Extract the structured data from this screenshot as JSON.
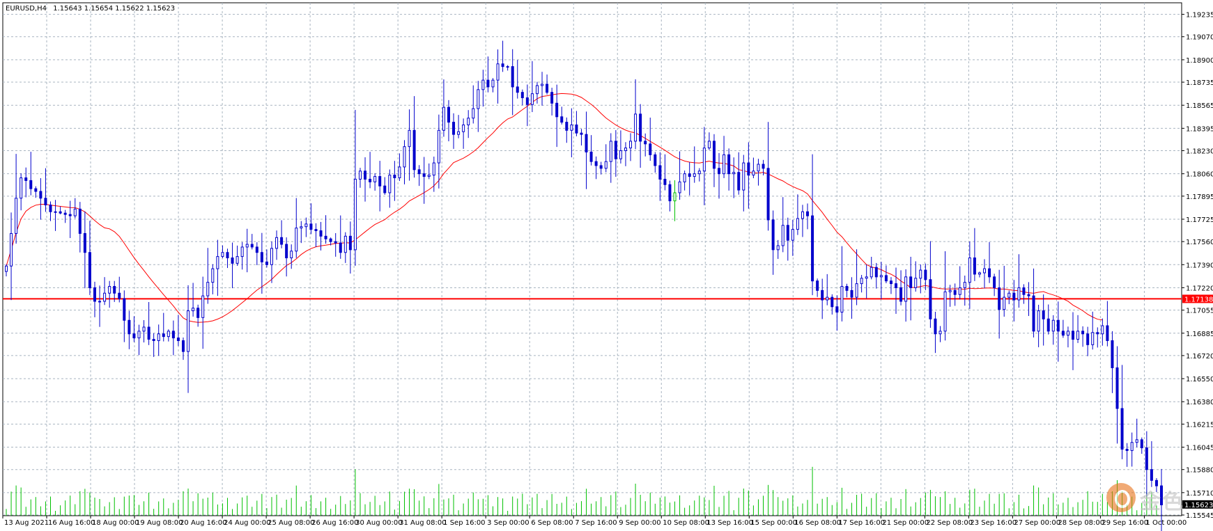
{
  "header": {
    "symbol": "EURUSD,H4",
    "ohlc": "1.15643 1.15654 1.15622 1.15623"
  },
  "current_price_label": "1.15623",
  "colors": {
    "bull": "#0000cc",
    "bear": "#0000cc",
    "ma": "#ff0000",
    "hline": "#ff0000",
    "volume": "#00c000",
    "grid": "#a8b4c0",
    "tag_bg": "#000000",
    "hline_tag_bg": "#ff0000",
    "highlight_candle": "#00c000"
  },
  "watermark": {
    "text": "金色",
    "icon": "jinse-logo-icon"
  },
  "chart_data": {
    "type": "candlestick",
    "title": "EURUSD,H4",
    "ylim": [
      1.1554,
      1.1932
    ],
    "yticks": [
      "1.19235",
      "1.19070",
      "1.18900",
      "1.18735",
      "1.18565",
      "1.18395",
      "1.18230",
      "1.18060",
      "1.17895",
      "1.17725",
      "1.17560",
      "1.17390",
      "1.17220",
      "1.17055",
      "1.16885",
      "1.16720",
      "1.16550",
      "1.16380",
      "1.16215",
      "1.16045",
      "1.15880",
      "1.15710",
      "1.15545"
    ],
    "xticks": [
      "13 Aug 2021",
      "16 Aug 16:00",
      "18 Aug 00:00",
      "19 Aug 08:00",
      "20 Aug 16:00",
      "24 Aug 00:00",
      "25 Aug 08:00",
      "26 Aug 16:00",
      "30 Aug 00:00",
      "31 Aug 08:00",
      "1 Sep 16:00",
      "3 Sep 00:00",
      "6 Sep 08:00",
      "7 Sep 16:00",
      "9 Sep 00:00",
      "10 Sep 08:00",
      "13 Sep 16:00",
      "15 Sep 00:00",
      "16 Sep 08:00",
      "17 Sep 16:00",
      "21 Sep 00:00",
      "22 Sep 08:00",
      "23 Sep 16:00",
      "27 Sep 00:00",
      "28 Sep 08:00",
      "29 Sep 16:00",
      "1 Oct 00:00"
    ],
    "horizontal_line": {
      "value": 1.17138,
      "label": "1.17138"
    },
    "closes": [
      1.1738,
      1.1762,
      1.1788,
      1.1803,
      1.1801,
      1.1795,
      1.1793,
      1.1788,
      1.1783,
      1.1778,
      1.1778,
      1.1777,
      1.1776,
      1.1775,
      1.178,
      1.1762,
      1.1748,
      1.1722,
      1.1712,
      1.1712,
      1.1718,
      1.1723,
      1.1718,
      1.1714,
      1.1698,
      1.1688,
      1.1685,
      1.169,
      1.1693,
      1.1684,
      1.1683,
      1.1688,
      1.1686,
      1.169,
      1.1685,
      1.1683,
      1.1675,
      1.1705,
      1.1707,
      1.17,
      1.1716,
      1.1726,
      1.1736,
      1.1745,
      1.1748,
      1.1744,
      1.174,
      1.1745,
      1.1752,
      1.1754,
      1.1752,
      1.1748,
      1.1741,
      1.1739,
      1.1751,
      1.1759,
      1.1754,
      1.1744,
      1.1749,
      1.1766,
      1.1767,
      1.1769,
      1.1765,
      1.1764,
      1.176,
      1.1758,
      1.1756,
      1.1755,
      1.1748,
      1.176,
      1.175,
      1.1802,
      1.1808,
      1.1802,
      1.18,
      1.1804,
      1.1797,
      1.1792,
      1.1805,
      1.1803,
      1.1811,
      1.1826,
      1.1838,
      1.1809,
      1.1806,
      1.1804,
      1.1805,
      1.1814,
      1.1838,
      1.1855,
      1.1844,
      1.1835,
      1.1837,
      1.1842,
      1.1847,
      1.1854,
      1.1868,
      1.1875,
      1.187,
      1.1875,
      1.1887,
      1.1885,
      1.1885,
      1.187,
      1.1866,
      1.1862,
      1.1857,
      1.1865,
      1.1871,
      1.1872,
      1.1866,
      1.1858,
      1.1848,
      1.1844,
      1.1838,
      1.1842,
      1.1836,
      1.1835,
      1.1822,
      1.1815,
      1.1812,
      1.181,
      1.1815,
      1.183,
      1.1817,
      1.1823,
      1.1825,
      1.183,
      1.185,
      1.183,
      1.1828,
      1.182,
      1.1812,
      1.1802,
      1.1798,
      1.1786,
      1.1792,
      1.18,
      1.1806,
      1.1804,
      1.1806,
      1.1808,
      1.1825,
      1.183,
      1.181,
      1.1806,
      1.182,
      1.1806,
      1.1807,
      1.1794,
      1.1814,
      1.1805,
      1.1808,
      1.1813,
      1.181,
      1.1772,
      1.175,
      1.1753,
      1.1768,
      1.1757,
      1.1765,
      1.1773,
      1.1778,
      1.1775,
      1.1727,
      1.172,
      1.1713,
      1.1715,
      1.1708,
      1.1704,
      1.1723,
      1.172,
      1.1715,
      1.1725,
      1.1729,
      1.173,
      1.1737,
      1.173,
      1.1731,
      1.1727,
      1.1725,
      1.1722,
      1.1712,
      1.173,
      1.1722,
      1.1729,
      1.1735,
      1.1728,
      1.1699,
      1.1688,
      1.169,
      1.1719,
      1.172,
      1.1717,
      1.1722,
      1.1726,
      1.1744,
      1.1732,
      1.1733,
      1.1736,
      1.173,
      1.1722,
      1.1706,
      1.1715,
      1.1718,
      1.1713,
      1.1722,
      1.1717,
      1.1716,
      1.169,
      1.1705,
      1.1699,
      1.169,
      1.1698,
      1.169,
      1.1687,
      1.169,
      1.1684,
      1.169,
      1.1688,
      1.168,
      1.1689,
      1.1688,
      1.1694,
      1.1683,
      1.1663,
      1.1633,
      1.1603,
      1.1602,
      1.1608,
      1.161,
      1.1604,
      1.1588,
      1.158,
      1.1576,
      1.1562
    ],
    "ma_period": 21
  }
}
